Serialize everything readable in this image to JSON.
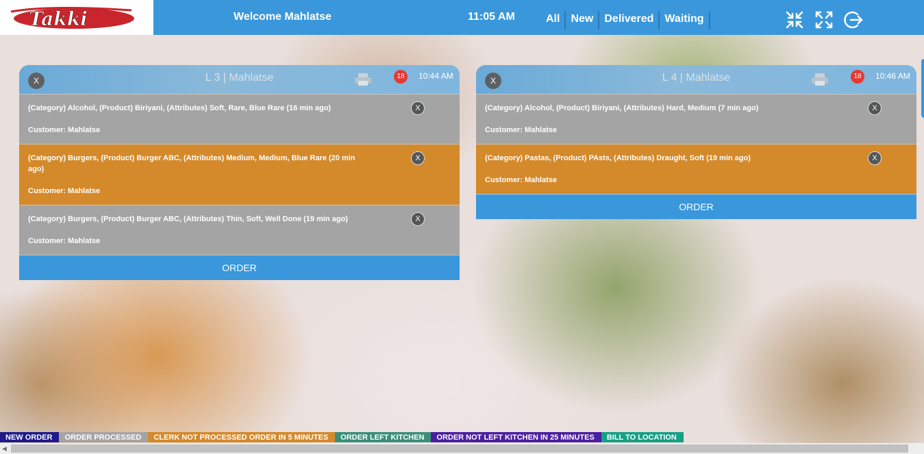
{
  "header": {
    "logo_text": "Takki",
    "welcome": "Welcome Mahlatse",
    "time": "11:05 AM",
    "filters": [
      "All",
      "New",
      "Delivered",
      "Waiting"
    ],
    "icons": [
      "collapse-icon",
      "expand-icon",
      "logout-icon"
    ]
  },
  "cards": [
    {
      "title": "L 3 | Mahlatse",
      "badge": "18",
      "time": "10:44 AM",
      "close": "X",
      "items": [
        {
          "text": "(Category) Alcohol, (Product) Biriyani, (Attributes) Soft, Rare, Blue Rare (16 min ago)",
          "customer": "Customer: Mahlatse",
          "status": "gray",
          "close": "X"
        },
        {
          "text": "(Category) Burgers, (Product) Burger ABC, (Attributes) Medium, Medium, Blue Rare (20 min ago)",
          "customer": "Customer: Mahlatse",
          "status": "orange",
          "close": "X"
        },
        {
          "text": "(Category) Burgers, (Product) Burger ABC, (Attributes) Thin, Soft, Well Done (19 min ago)",
          "customer": "Customer: Mahlatse",
          "status": "gray",
          "close": "X"
        }
      ],
      "order_label": "ORDER"
    },
    {
      "title": "L 4 | Mahlatse",
      "badge": "18",
      "time": "10:46 AM",
      "close": "X",
      "items": [
        {
          "text": "(Category) Alcohol, (Product) Biriyani, (Attributes) Hard, Medium (7 min ago)",
          "customer": "Customer: Mahlatse",
          "status": "gray",
          "close": "X"
        },
        {
          "text": "(Category) Pastas, (Product) PAsts, (Attributes) Draught, Soft (19 min ago)",
          "customer": "Customer: Mahlatse",
          "status": "orange",
          "close": "X"
        }
      ],
      "order_label": "ORDER"
    }
  ],
  "legend": [
    {
      "label": "NEW ORDER",
      "color": "#1f1a8a"
    },
    {
      "label": "ORDER PROCESSED",
      "color": "#a4a4a4"
    },
    {
      "label": "CLERK NOT PROCESSED ORDER IN 5 MINUTES",
      "color": "#d4892a"
    },
    {
      "label": "ORDER LEFT KITCHEN",
      "color": "#3a8f7a"
    },
    {
      "label": "ORDER NOT LEFT KITCHEN IN 25 MINUTES",
      "color": "#4b1fa0"
    },
    {
      "label": "BILL TO LOCATION",
      "color": "#16a085"
    }
  ],
  "colors": {
    "accent": "#3a97db",
    "processed": "#a4a4a4",
    "warning": "#d4892a",
    "badge": "#e53935"
  }
}
